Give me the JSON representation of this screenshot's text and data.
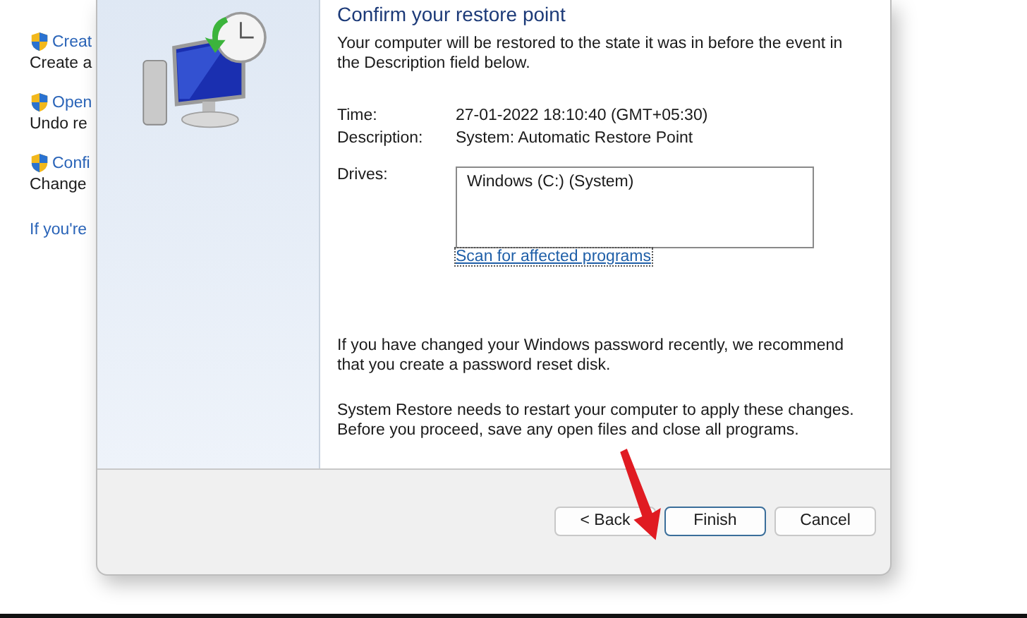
{
  "background_window": {
    "items": [
      {
        "link": "Creat",
        "text": "Create a"
      },
      {
        "link": "Open",
        "text": "Undo re"
      },
      {
        "link": "Confi",
        "text": "Change"
      }
    ],
    "footer_link": "If you're"
  },
  "dialog": {
    "heading": "Confirm your restore point",
    "intro": "Your computer will be restored to the state it was in before the event in the Description field below.",
    "fields": [
      {
        "label": "Time:",
        "value": "27-01-2022 18:10:40 (GMT+05:30)"
      },
      {
        "label": "Description:",
        "value": "System: Automatic Restore Point"
      }
    ],
    "drives_label": "Drives:",
    "drives": [
      "Windows (C:) (System)"
    ],
    "scan_link": "Scan for affected programs",
    "notes": [
      "If you have changed your Windows password recently, we recommend that you create a password reset disk.",
      "System Restore needs to restart your computer to apply these changes. Before you proceed, save any open files and close all programs."
    ],
    "buttons": [
      {
        "label": "< Back",
        "selected": false
      },
      {
        "label": "Finish",
        "selected": true
      },
      {
        "label": "Cancel",
        "selected": false
      }
    ]
  }
}
